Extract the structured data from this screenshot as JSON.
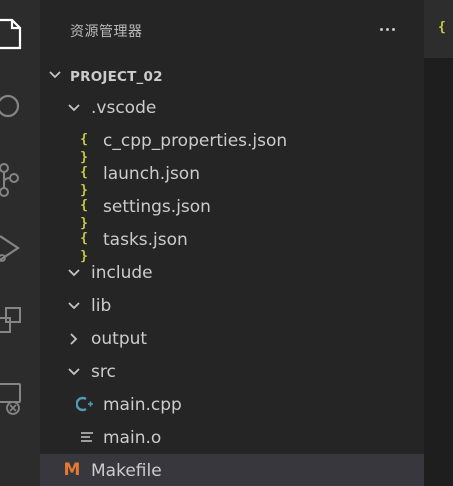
{
  "sidebar": {
    "title": "资源管理器",
    "more_label": "···"
  },
  "tree": {
    "root": "PROJECT_02",
    "vscode_folder": ".vscode",
    "files_vscode": [
      "c_cpp_properties.json",
      "launch.json",
      "settings.json",
      "tasks.json"
    ],
    "include_folder": "include",
    "lib_folder": "lib",
    "output_folder": "output",
    "src_folder": "src",
    "files_src": [
      "main.cpp",
      "main.o"
    ],
    "makefile": "Makefile"
  },
  "icons": {
    "json": "{ }",
    "cpp": "G",
    "plain": "≡",
    "make": "M"
  },
  "colors": {
    "json": "#cbcb41",
    "cpp": "#519aba",
    "make": "#e37933",
    "selected_row": "#37373d"
  }
}
